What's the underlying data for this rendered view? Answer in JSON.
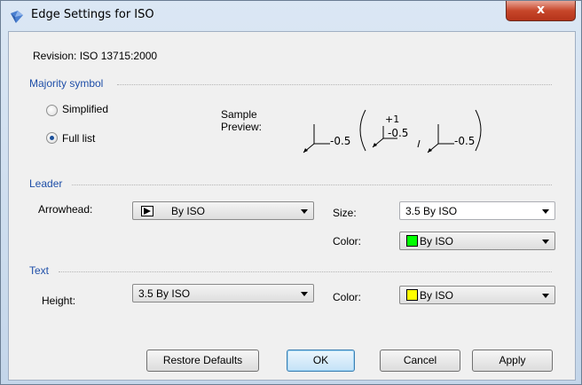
{
  "window": {
    "title": "Edge Settings for ISO",
    "close_label": "x"
  },
  "revision": "Revision: ISO 13715:2000",
  "majority": {
    "group_label": "Majority symbol",
    "options": [
      "Simplified",
      "Full list"
    ],
    "selected": "Full list",
    "sample_label_1": "Sample",
    "sample_label_2": "Preview:",
    "preview": {
      "value1": "-0.5",
      "value2_top": "+1",
      "value2_bottom": "-0.5",
      "value3": "-0.5"
    }
  },
  "leader": {
    "group_label": "Leader",
    "arrowhead_label": "Arrowhead:",
    "arrowhead_value": "By ISO",
    "size_label": "Size:",
    "size_value": "3.5 By ISO",
    "color_label": "Color:",
    "color_value": "By ISO",
    "color_swatch": "#00ff00"
  },
  "text": {
    "group_label": "Text",
    "height_label": "Height:",
    "height_value": "3.5 By ISO",
    "color_label": "Color:",
    "color_value": "By ISO",
    "color_swatch": "#ffff00"
  },
  "buttons": {
    "restore": "Restore Defaults",
    "ok": "OK",
    "cancel": "Cancel",
    "apply": "Apply"
  },
  "colors": {
    "accent": "#1f4fa8"
  }
}
